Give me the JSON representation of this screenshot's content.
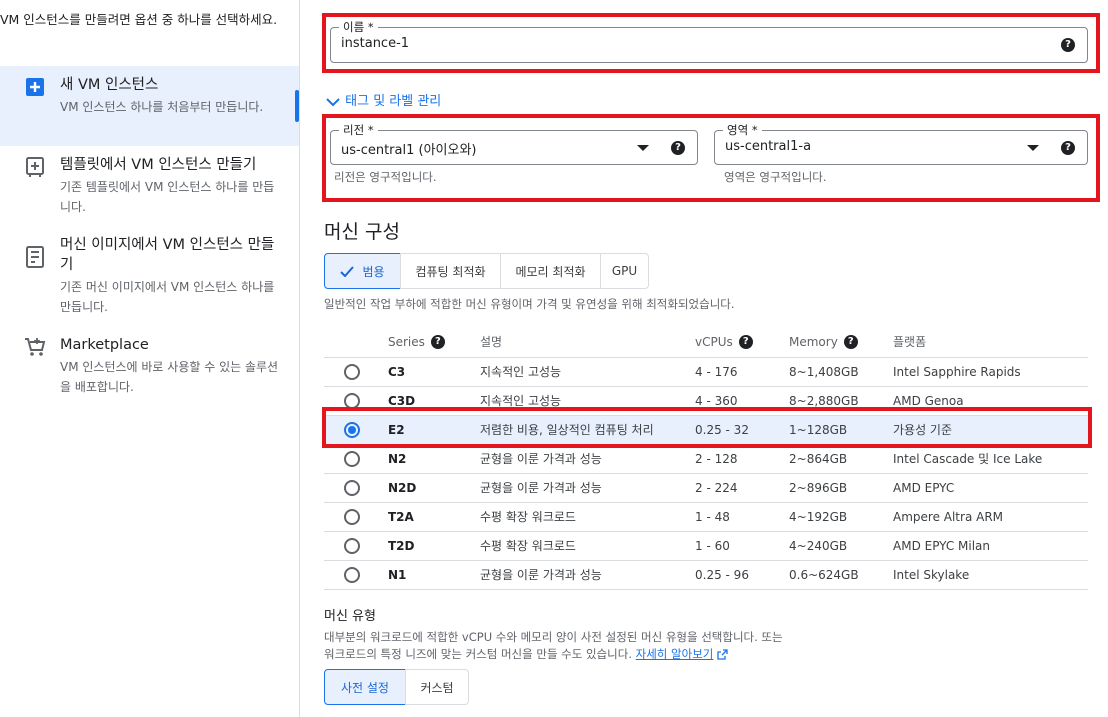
{
  "sidebar": {
    "intro": "VM 인스턴스를 만들려면 옵션 중 하나를 선택하세요.",
    "options": [
      {
        "title": "새 VM 인스턴스",
        "desc": "VM 인스턴스 하나를 처음부터 만듭니다.",
        "icon": "add-box-icon",
        "selected": true
      },
      {
        "title": "템플릿에서 VM 인스턴스 만들기",
        "desc": "기존 템플릿에서 VM 인스턴스 하나를 만듭니다.",
        "icon": "template-add-icon"
      },
      {
        "title": "머신 이미지에서 VM 인스턴스 만들기",
        "desc": "기존 머신 이미지에서 VM 인스턴스 하나를 만듭니다.",
        "icon": "machine-image-icon"
      },
      {
        "title": "Marketplace",
        "desc": "VM 인스턴스에 바로 사용할 수 있는 솔루션을 배포합니다.",
        "icon": "cart-icon"
      }
    ]
  },
  "form": {
    "name_label": "이름 *",
    "name_value": "instance-1",
    "tags_link": "태그 및 라벨 관리",
    "region_label": "리전 *",
    "region_value": "us-central1 (아이오와)",
    "region_hint": "리전은 영구적입니다.",
    "zone_label": "영역 *",
    "zone_value": "us-central1-a",
    "zone_hint": "영역은 영구적입니다."
  },
  "machine_config": {
    "heading": "머신 구성",
    "tabs": [
      "범용",
      "컴퓨팅 최적화",
      "메모리 최적화",
      "GPU"
    ],
    "selected_tab": "범용",
    "description": "일반적인 작업 부하에 적합한 머신 유형이며 가격 및 유연성을 위해 최적화되었습니다.",
    "columns": [
      "Series",
      "설명",
      "vCPUs",
      "Memory",
      "플랫폼"
    ],
    "rows": [
      {
        "series": "C3",
        "desc": "지속적인 고성능",
        "vcpus": "4 - 176",
        "memory": "8~1,408GB",
        "platform": "Intel Sapphire Rapids",
        "selected": false
      },
      {
        "series": "C3D",
        "desc": "지속적인 고성능",
        "vcpus": "4 - 360",
        "memory": "8~2,880GB",
        "platform": "AMD Genoa",
        "selected": false
      },
      {
        "series": "E2",
        "desc": "저렴한 비용, 일상적인 컴퓨팅 처리",
        "vcpus": "0.25 - 32",
        "memory": "1~128GB",
        "platform": "가용성 기준",
        "selected": true
      },
      {
        "series": "N2",
        "desc": "균형을 이룬 가격과 성능",
        "vcpus": "2 - 128",
        "memory": "2~864GB",
        "platform": "Intel Cascade 및 Ice Lake",
        "selected": false
      },
      {
        "series": "N2D",
        "desc": "균형을 이룬 가격과 성능",
        "vcpus": "2 - 224",
        "memory": "2~896GB",
        "platform": "AMD EPYC",
        "selected": false
      },
      {
        "series": "T2A",
        "desc": "수평 확장 워크로드",
        "vcpus": "1 - 48",
        "memory": "4~192GB",
        "platform": "Ampere Altra ARM",
        "selected": false
      },
      {
        "series": "T2D",
        "desc": "수평 확장 워크로드",
        "vcpus": "1 - 60",
        "memory": "4~240GB",
        "platform": "AMD EPYC Milan",
        "selected": false
      },
      {
        "series": "N1",
        "desc": "균형을 이룬 가격과 성능",
        "vcpus": "0.25 - 96",
        "memory": "0.6~624GB",
        "platform": "Intel Skylake",
        "selected": false
      }
    ]
  },
  "machine_type": {
    "heading": "머신 유형",
    "desc_line1": "대부분의 워크로드에 적합한 vCPU 수와 메모리 양이 사전 설정된 머신 유형을 선택합니다. 또는",
    "desc_line2": "워크로드의 특정 니즈에 맞는 커스텀 머신을 만들 수도 있습니다.",
    "learn_more": "자세히 알아보기",
    "tabs": [
      "사전 설정",
      "커스텀"
    ],
    "selected_tab": "사전 설정"
  },
  "colors": {
    "accent": "#1a73e8",
    "highlight": "#e3161f",
    "selected_bg": "#e8f0fe"
  }
}
